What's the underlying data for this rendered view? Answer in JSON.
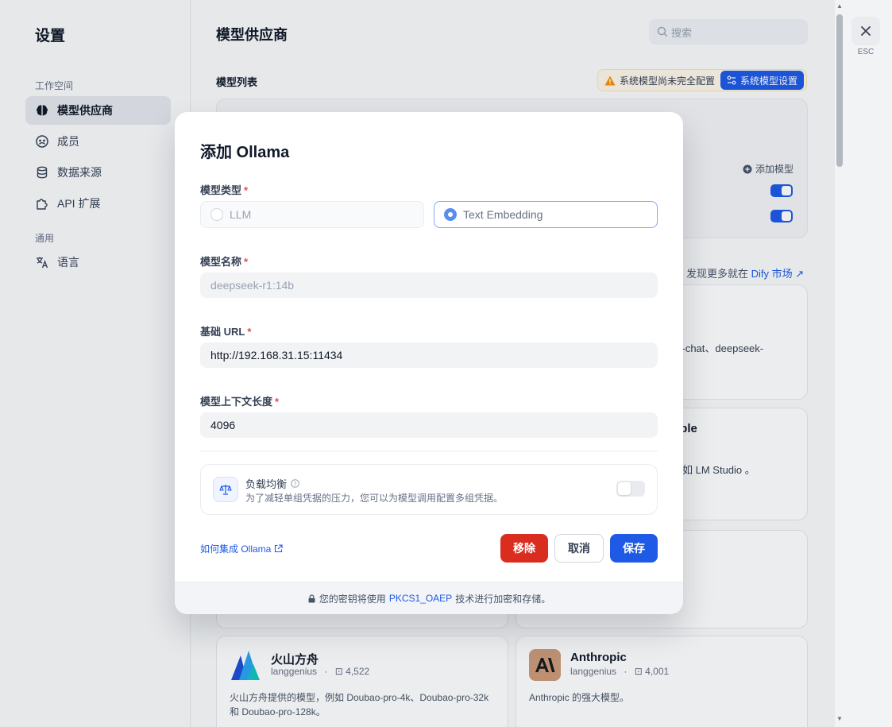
{
  "sidebar": {
    "title": "设置",
    "group_workspace": "工作空间",
    "group_general": "通用",
    "items": [
      {
        "label": "模型供应商",
        "icon": "brain-icon"
      },
      {
        "label": "成员",
        "icon": "members-icon"
      },
      {
        "label": "数据来源",
        "icon": "database-icon"
      },
      {
        "label": "API 扩展",
        "icon": "puzzle-icon"
      },
      {
        "label": "语言",
        "icon": "translate-icon"
      }
    ]
  },
  "main": {
    "title": "模型供应商",
    "search_placeholder": "搜索",
    "section_label": "模型列表",
    "warning": "系统模型尚未完全配置",
    "system_settings": "系统模型设置",
    "add_model": "添加模型",
    "market_prefix": "发现更多就在",
    "market_link": "Dify 市场",
    "frag_deepseek": "k-chat、deepseek-",
    "frag_ible": "ible",
    "frag_lmstudio": "如 LM Studio 。",
    "providers": [
      {
        "name": "火山方舟",
        "author": "langgenius",
        "installs": "4,522",
        "desc": "火山方舟提供的模型，例如 Doubao-pro-4k、Doubao-pro-32k 和 Doubao-pro-128k。"
      },
      {
        "name": "Anthropic",
        "author": "langgenius",
        "installs": "4,001",
        "desc": "Anthropic 的强大模型。"
      }
    ]
  },
  "esc_label": "ESC",
  "modal": {
    "title": "添加 Ollama",
    "model_type_label": "模型类型",
    "required_mark": "*",
    "option_llm": "LLM",
    "option_embedding": "Text Embedding",
    "model_name_label": "模型名称",
    "model_name_value": "deepseek-r1:14b",
    "base_url_label": "基础 URL",
    "base_url_value": "http://192.168.31.15:11434",
    "context_label": "模型上下文长度",
    "context_value": "4096",
    "lb_title": "负载均衡",
    "lb_desc": "为了减轻单组凭据的压力，您可以为模型调用配置多组凭据。",
    "help_link": "如何集成 Ollama",
    "remove": "移除",
    "cancel": "取消",
    "save": "保存",
    "footer_prefix": "您的密钥将使用",
    "footer_highlight": "PKCS1_OAEP",
    "footer_suffix": "技术进行加密和存储。"
  }
}
